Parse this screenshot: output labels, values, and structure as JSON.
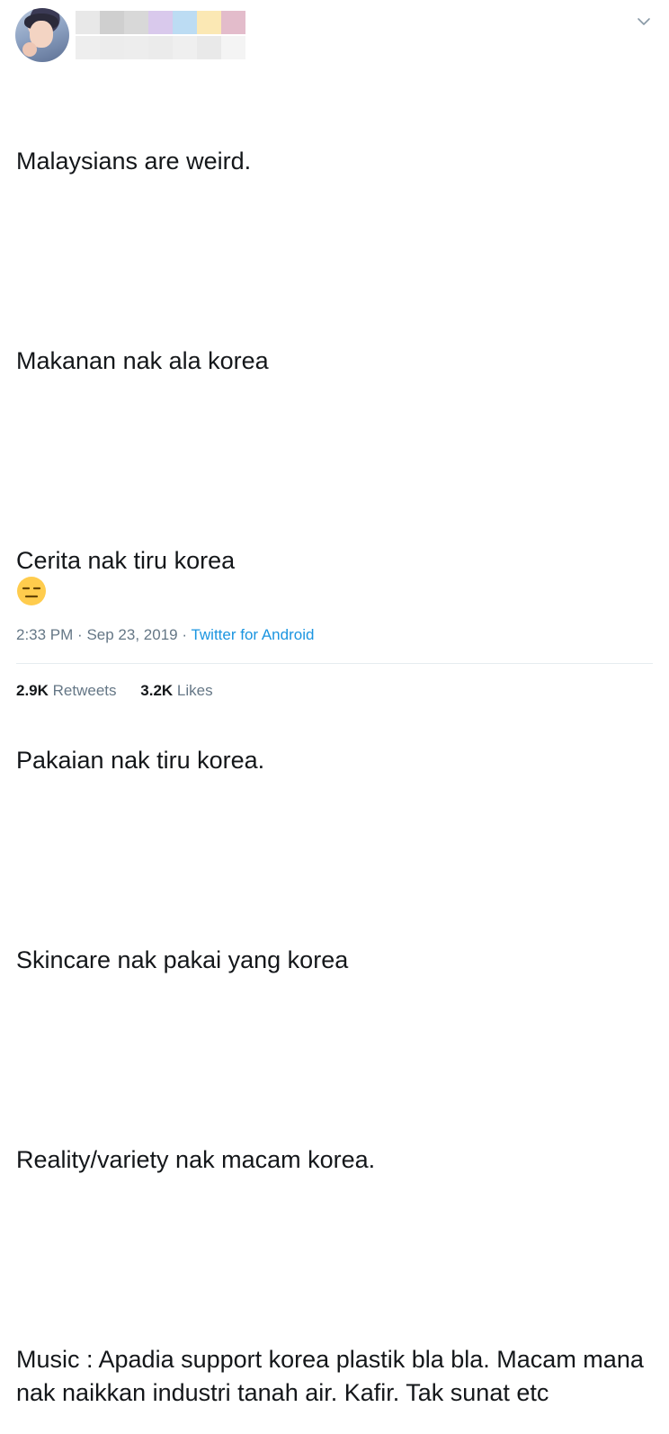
{
  "tweet": {
    "lines": [
      "Malaysians are weird.",
      "Makanan nak ala korea",
      "Cerita nak tiru korea",
      "Pakaian nak tiru korea.",
      "Skincare nak pakai yang korea",
      "Reality/variety nak macam korea.",
      "Music : Apadia support korea plastik bla bla. Macam mana nak naikkan industri tanah air. Kafir. Tak sunat etc"
    ],
    "emoji": "expressionless-face"
  },
  "meta": {
    "time": "2:33 PM",
    "separator1": "·",
    "date": "Sep 23, 2019",
    "separator2": "·",
    "source": "Twitter for Android"
  },
  "stats": {
    "retweets_count": "2.9K",
    "retweets_label": "Retweets",
    "likes_count": "3.2K",
    "likes_label": "Likes"
  },
  "colors": {
    "text": "#14171a",
    "muted": "#657786",
    "link": "#1b95e0",
    "divider": "#e6ecf0",
    "name_blur": [
      "#e8e8e8",
      "#cfcfcf",
      "#d8d8d8",
      "#d9c9ec",
      "#bcdcf3",
      "#fbe8b4",
      "#e3bccb"
    ],
    "handle_blur": [
      "#eeeeee",
      "#ececec",
      "#ededed",
      "#ebebeb",
      "#efefef",
      "#e9e9e9",
      "#f4f4f4"
    ]
  },
  "icons": {
    "avatar": "user-avatar",
    "menu": "chevron-down-icon"
  }
}
